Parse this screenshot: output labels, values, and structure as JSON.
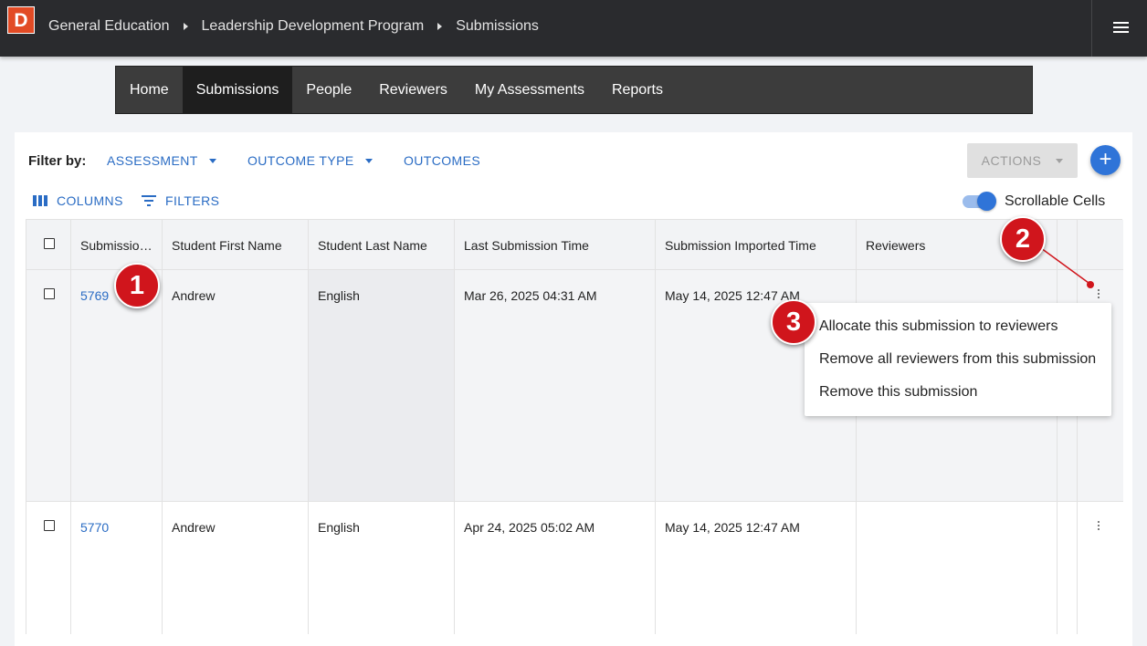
{
  "app": {
    "logo_letter": "D",
    "breadcrumbs": [
      "General Education",
      "Leadership Development Program",
      "Submissions"
    ]
  },
  "nav": {
    "items": [
      "Home",
      "Submissions",
      "People",
      "Reviewers",
      "My Assessments",
      "Reports"
    ],
    "active": "Submissions"
  },
  "filters": {
    "label": "Filter by:",
    "assessment": "ASSESSMENT",
    "outcome_type": "OUTCOME TYPE",
    "outcomes": "OUTCOMES"
  },
  "toolbar": {
    "actions": "ACTIONS",
    "add": "+",
    "columns": "COLUMNS",
    "filters": "FILTERS",
    "scrollable_cells": "Scrollable Cells",
    "scrollable_cells_on": true
  },
  "table": {
    "headers": [
      "Submissio…",
      "Student First Name",
      "Student Last Name",
      "Last Submission Time",
      "Submission Imported Time",
      "Reviewers"
    ],
    "rows": [
      {
        "id": "5769",
        "first": "Andrew",
        "last": "English",
        "last_sub": "Mar 26, 2025 04:31 AM",
        "imported": "May 14, 2025 12:47 AM",
        "reviewers": ""
      },
      {
        "id": "5770",
        "first": "Andrew",
        "last": "English",
        "last_sub": "Apr 24, 2025 05:02 AM",
        "imported": "May 14, 2025 12:47 AM",
        "reviewers": ""
      }
    ]
  },
  "context_menu": {
    "items": [
      "Allocate this submission to reviewers",
      "Remove all reviewers from this submission",
      "Remove this submission"
    ]
  },
  "callouts": [
    "1",
    "2",
    "3"
  ],
  "colors": {
    "topbar": "#2a2b2e",
    "logo": "#e24b25",
    "link": "#2a6cc4",
    "primary": "#2f74d8",
    "callout": "#d0151c"
  }
}
